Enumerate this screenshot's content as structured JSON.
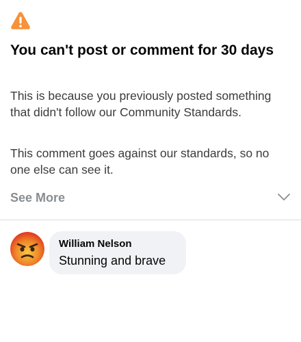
{
  "notice": {
    "icon": "warning-icon",
    "accent_color": "#f7923b",
    "title": "You can't post or comment for 30 days",
    "reason": "This is because you previously posted something that didn't follow our Community Standards.",
    "detail": "This comment goes against our standards, so no one else can see it.",
    "see_more_label": "See More",
    "expand_icon": "chevron-down-icon"
  },
  "comment": {
    "avatar_icon": "angry-face-emoji",
    "author": "William Nelson",
    "text": "Stunning and brave"
  }
}
